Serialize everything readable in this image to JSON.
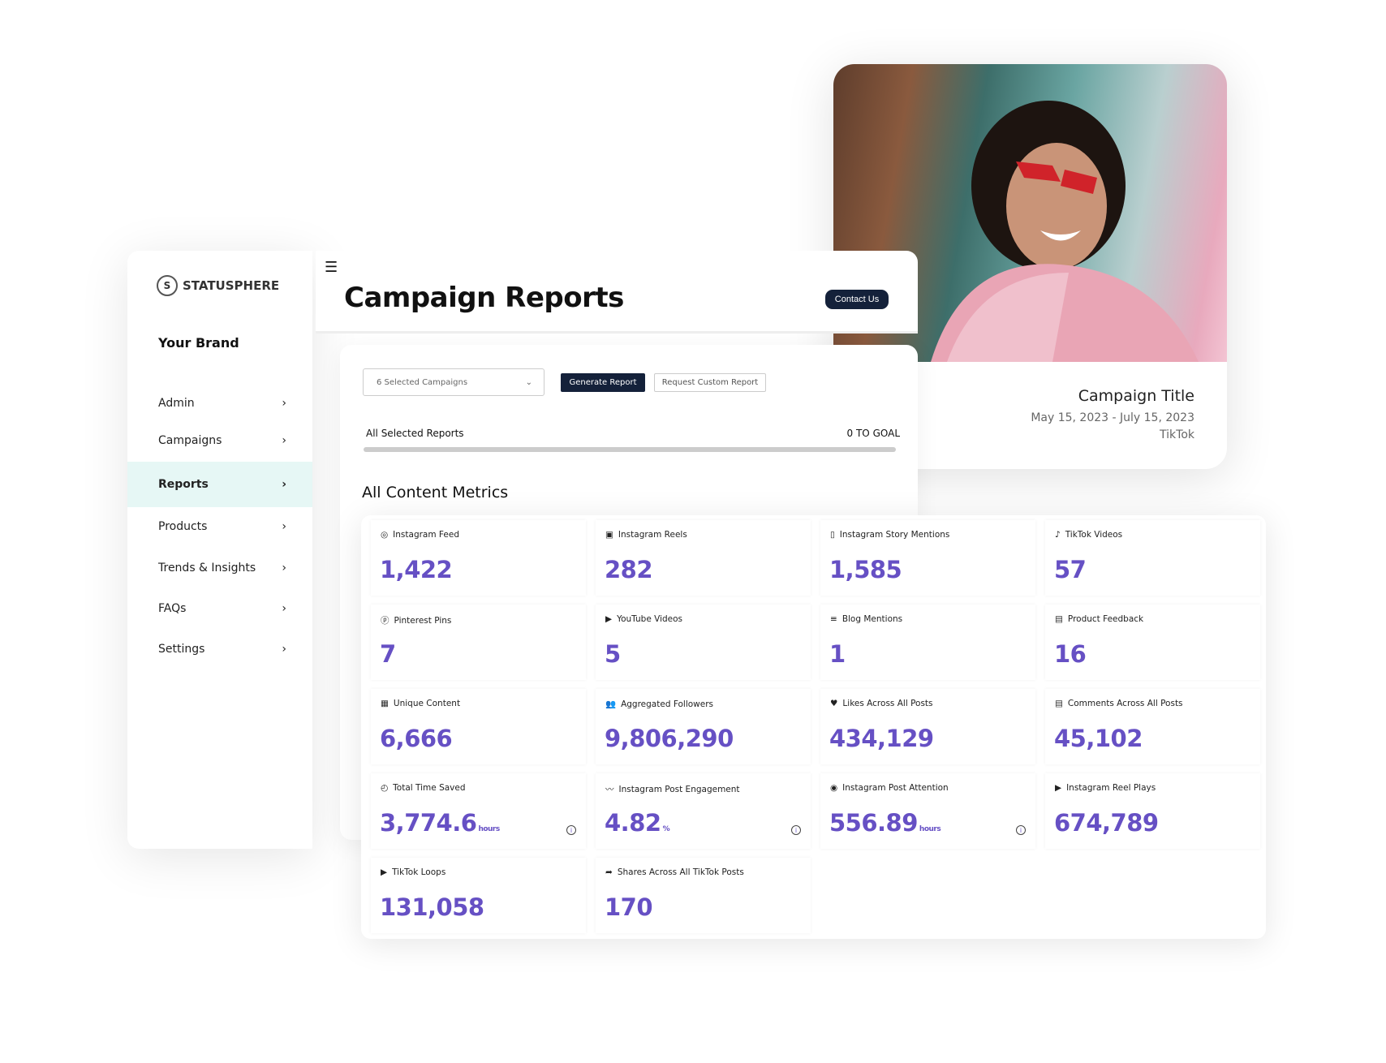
{
  "photo_card": {
    "title": "Campaign Title",
    "dates": "May 15, 2023 - July 15, 2023",
    "platform": "TikTok"
  },
  "sidebar": {
    "logo": "STATUSPHERE",
    "brand": "Your Brand",
    "items": [
      {
        "label": "Admin"
      },
      {
        "label": "Campaigns"
      },
      {
        "label": "Reports",
        "active": true
      },
      {
        "label": "Products"
      },
      {
        "label": "Trends & Insights"
      },
      {
        "label": "FAQs"
      },
      {
        "label": "Settings"
      }
    ]
  },
  "header": {
    "title": "Campaign Reports",
    "contact_label": "Contact Us"
  },
  "controls": {
    "campaign_select": "6 Selected Campaigns",
    "generate_label": "Generate Report",
    "request_label": "Request Custom Report"
  },
  "progress": {
    "label": "All Selected Reports",
    "goal_text": "0 TO GOAL",
    "value": 0
  },
  "metrics_title": "All Content Metrics",
  "accent_color": "#6650c4",
  "metrics": [
    {
      "label": "Instagram Feed",
      "value": "1,422",
      "icon": "instagram-icon"
    },
    {
      "label": "Instagram Reels",
      "value": "282",
      "icon": "reels-icon"
    },
    {
      "label": "Instagram Story Mentions",
      "value": "1,585",
      "icon": "story-icon"
    },
    {
      "label": "TikTok Videos",
      "value": "57",
      "icon": "tiktok-icon"
    },
    {
      "label": "Pinterest Pins",
      "value": "7",
      "icon": "pinterest-icon"
    },
    {
      "label": "YouTube Videos",
      "value": "5",
      "icon": "youtube-icon"
    },
    {
      "label": "Blog Mentions",
      "value": "1",
      "icon": "blog-icon"
    },
    {
      "label": "Product Feedback",
      "value": "16",
      "icon": "feedback-icon"
    },
    {
      "label": "Unique Content",
      "value": "6,666",
      "icon": "content-icon"
    },
    {
      "label": "Aggregated Followers",
      "value": "9,806,290",
      "icon": "followers-icon"
    },
    {
      "label": "Likes Across All Posts",
      "value": "434,129",
      "icon": "heart-icon"
    },
    {
      "label": "Comments Across All Posts",
      "value": "45,102",
      "icon": "comment-icon"
    },
    {
      "label": "Total Time Saved",
      "value": "3,774.6",
      "unit": "hours",
      "info": true,
      "icon": "timer-icon"
    },
    {
      "label": "Instagram Post Engagement",
      "value": "4.82",
      "unit": "%",
      "info": true,
      "icon": "trend-icon"
    },
    {
      "label": "Instagram Post Attention",
      "value": "556.89",
      "unit": "hours",
      "info": true,
      "icon": "eye-icon"
    },
    {
      "label": "Instagram Reel Plays",
      "value": "674,789",
      "icon": "play-icon"
    },
    {
      "label": "TikTok Loops",
      "value": "131,058",
      "icon": "play-icon"
    },
    {
      "label": "Shares Across All TikTok Posts",
      "value": "170",
      "icon": "share-icon"
    }
  ]
}
